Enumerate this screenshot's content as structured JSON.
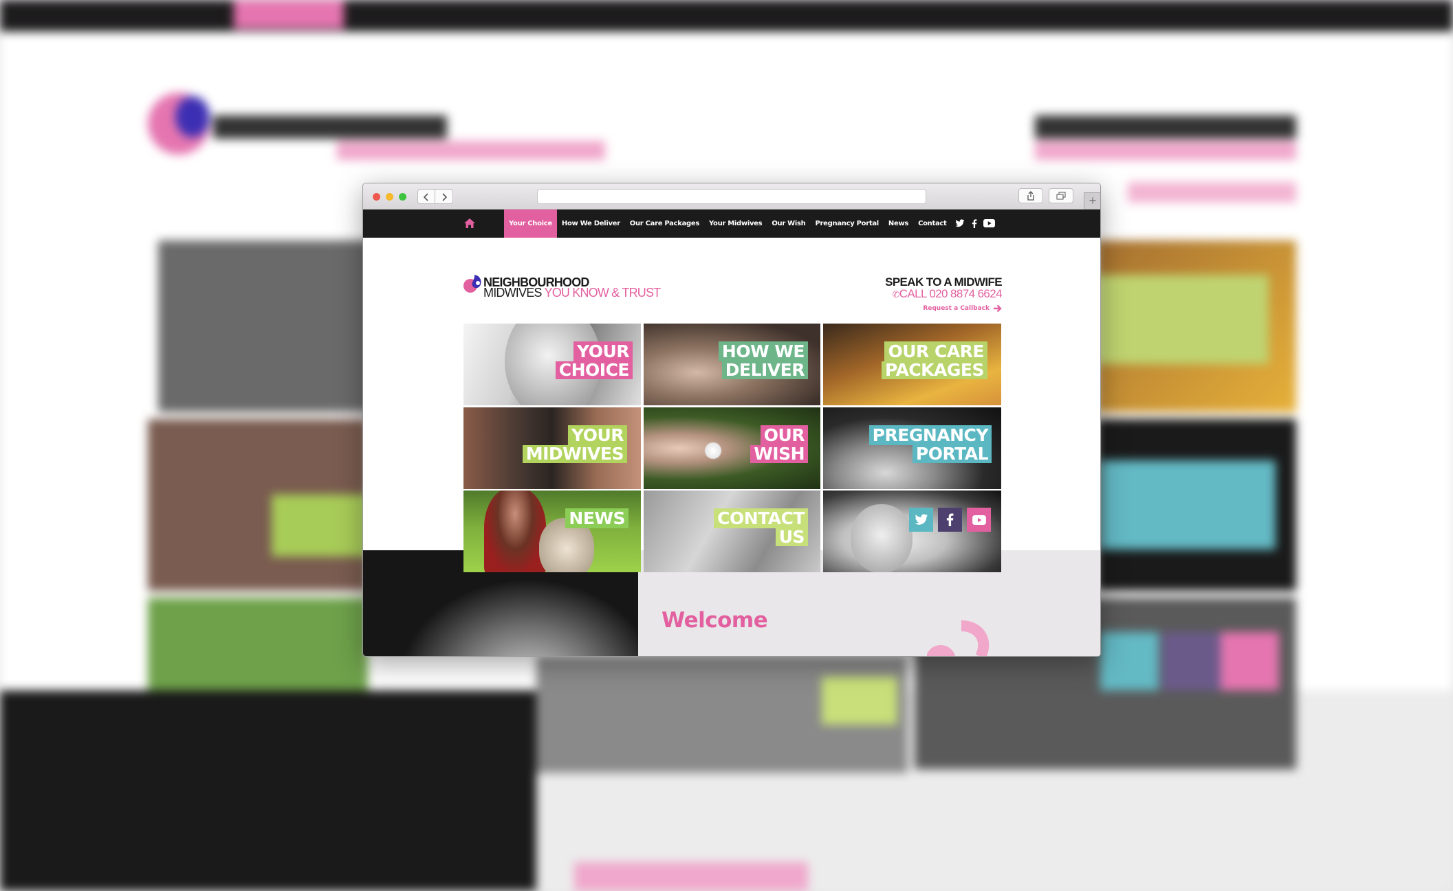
{
  "nav": {
    "items": [
      "Your Choice",
      "How We Deliver",
      "Our Care Packages",
      "Your Midwives",
      "Our Wish",
      "Pregnancy Portal",
      "News",
      "Contact"
    ],
    "active_index": 0
  },
  "brand": {
    "line1": "NEIGHBOURHOOD",
    "line2a": "MIDWIVES",
    "line2b": "YOU KNOW & TRUST"
  },
  "contact": {
    "heading": "SPEAK TO A MIDWIFE",
    "phone": "CALL 020 8874 6624",
    "callback": "Request a Callback"
  },
  "tiles": [
    {
      "lines": [
        "YOUR",
        "CHOICE"
      ],
      "color": "#e2609f"
    },
    {
      "lines": [
        "HOW WE",
        "DELIVER"
      ],
      "color": "#6fb58a"
    },
    {
      "lines": [
        "OUR CARE",
        "PACKAGES"
      ],
      "color": "#b7d36a"
    },
    {
      "lines": [
        "YOUR",
        "MIDWIVES"
      ],
      "color": "#b2d35d"
    },
    {
      "lines": [
        "OUR",
        "WISH"
      ],
      "color": "#e2609f"
    },
    {
      "lines": [
        "PREGNANCY",
        "PORTAL"
      ],
      "color": "#5bb8c2"
    },
    {
      "lines": [
        "NEWS"
      ],
      "color": "#8ccd57"
    },
    {
      "lines": [
        "CONTACT",
        "US"
      ],
      "color": "#c8e07a"
    }
  ],
  "welcome": "Welcome",
  "social": [
    "twitter-icon",
    "facebook-icon",
    "youtube-icon"
  ],
  "colors": {
    "accent": "#e2609f",
    "dark": "#1c1b1c",
    "brand_blue": "#3d2fb3"
  }
}
